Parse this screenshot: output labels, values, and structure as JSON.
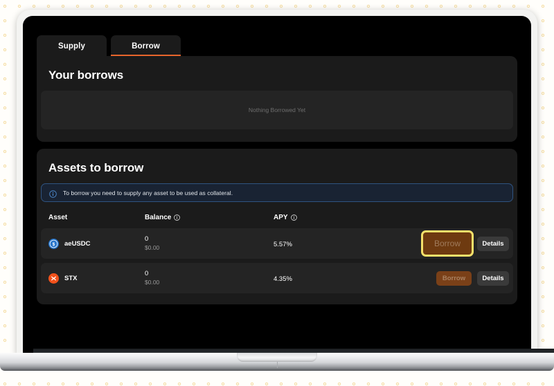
{
  "app": {
    "tabs": [
      {
        "label": "Supply",
        "active": false
      },
      {
        "label": "Borrow",
        "active": true
      }
    ],
    "accent_color": "#e8652c"
  },
  "your_borrows": {
    "title": "Your borrows",
    "empty_message": "Nothing Borrowed Yet"
  },
  "assets_to_borrow": {
    "title": "Assets to borrow",
    "notice": {
      "icon": "info-circle-icon",
      "text": "To borrow you need to supply any asset to be used as collateral.",
      "border_color": "#2f5481",
      "background_color": "#192333"
    },
    "columns": [
      {
        "label": "Asset",
        "has_info_icon": false
      },
      {
        "label": "Balance",
        "has_info_icon": true
      },
      {
        "label": "APY",
        "has_info_icon": true
      }
    ],
    "rows": [
      {
        "asset": "aeUSDC",
        "icon": "usdc-coin-icon",
        "icon_color": "#2775ca",
        "balance": "0",
        "balance_usd": "$0.00",
        "apy": "5.57%",
        "borrow_label": "Borrow",
        "details_label": "Details",
        "borrow_highlighted": true
      },
      {
        "asset": "STX",
        "icon": "stacks-coin-icon",
        "icon_color": "#f2511b",
        "balance": "0",
        "balance_usd": "$0.00",
        "apy": "4.35%",
        "borrow_label": "Borrow",
        "details_label": "Details",
        "borrow_highlighted": false
      }
    ]
  },
  "highlight": {
    "color": "#f5e06a"
  }
}
